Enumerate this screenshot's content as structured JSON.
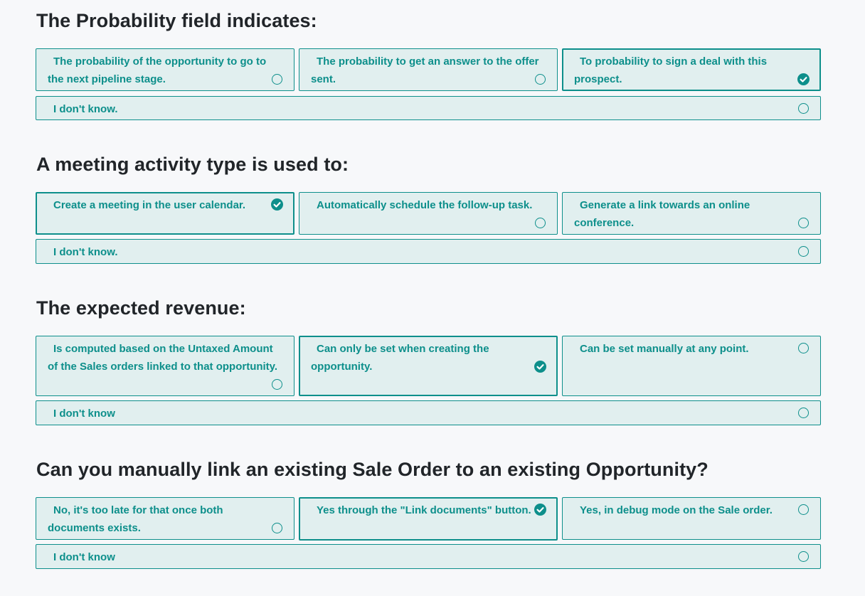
{
  "colors": {
    "accent": "#0d8f8b",
    "option_background": "#e1efef",
    "page_background": "#f7f8fa",
    "title": "#212529"
  },
  "icons": {
    "unselected": "radio-circle-icon",
    "selected": "check-circle-icon"
  },
  "questions": [
    {
      "title": "The Probability field indicates:",
      "options": [
        {
          "label": "The probability of the opportunity to go to the next pipeline stage.",
          "selected": false
        },
        {
          "label": "The probability to get an answer to the offer sent.",
          "selected": false
        },
        {
          "label": "To probability to sign a deal with this prospect.",
          "selected": true
        },
        {
          "label": "I don't know.",
          "selected": false
        }
      ]
    },
    {
      "title": "A meeting activity type is used to:",
      "options": [
        {
          "label": "Create a meeting in the user calendar.",
          "selected": true
        },
        {
          "label": "Automatically schedule the follow-up task.",
          "selected": false
        },
        {
          "label": "Generate a link towards an online conference.",
          "selected": false
        },
        {
          "label": "I don't know.",
          "selected": false
        }
      ]
    },
    {
      "title": "The expected revenue:",
      "options": [
        {
          "label": "Is computed based on the Untaxed Amount of the Sales orders linked to that opportunity.",
          "selected": false
        },
        {
          "label": "Can only be set when creating the opportunity.",
          "selected": true
        },
        {
          "label": "Can be set manually at any point.",
          "selected": false
        },
        {
          "label": "I don't know",
          "selected": false
        }
      ]
    },
    {
      "title": "Can you manually link an existing Sale Order to an existing Opportunity?",
      "options": [
        {
          "label": "No, it's too late for that once both documents exists.",
          "selected": false
        },
        {
          "label": "Yes through the \"Link documents\" button.",
          "selected": true
        },
        {
          "label": "Yes, in debug mode on the Sale order.",
          "selected": false
        },
        {
          "label": "I don't know",
          "selected": false
        }
      ]
    }
  ]
}
